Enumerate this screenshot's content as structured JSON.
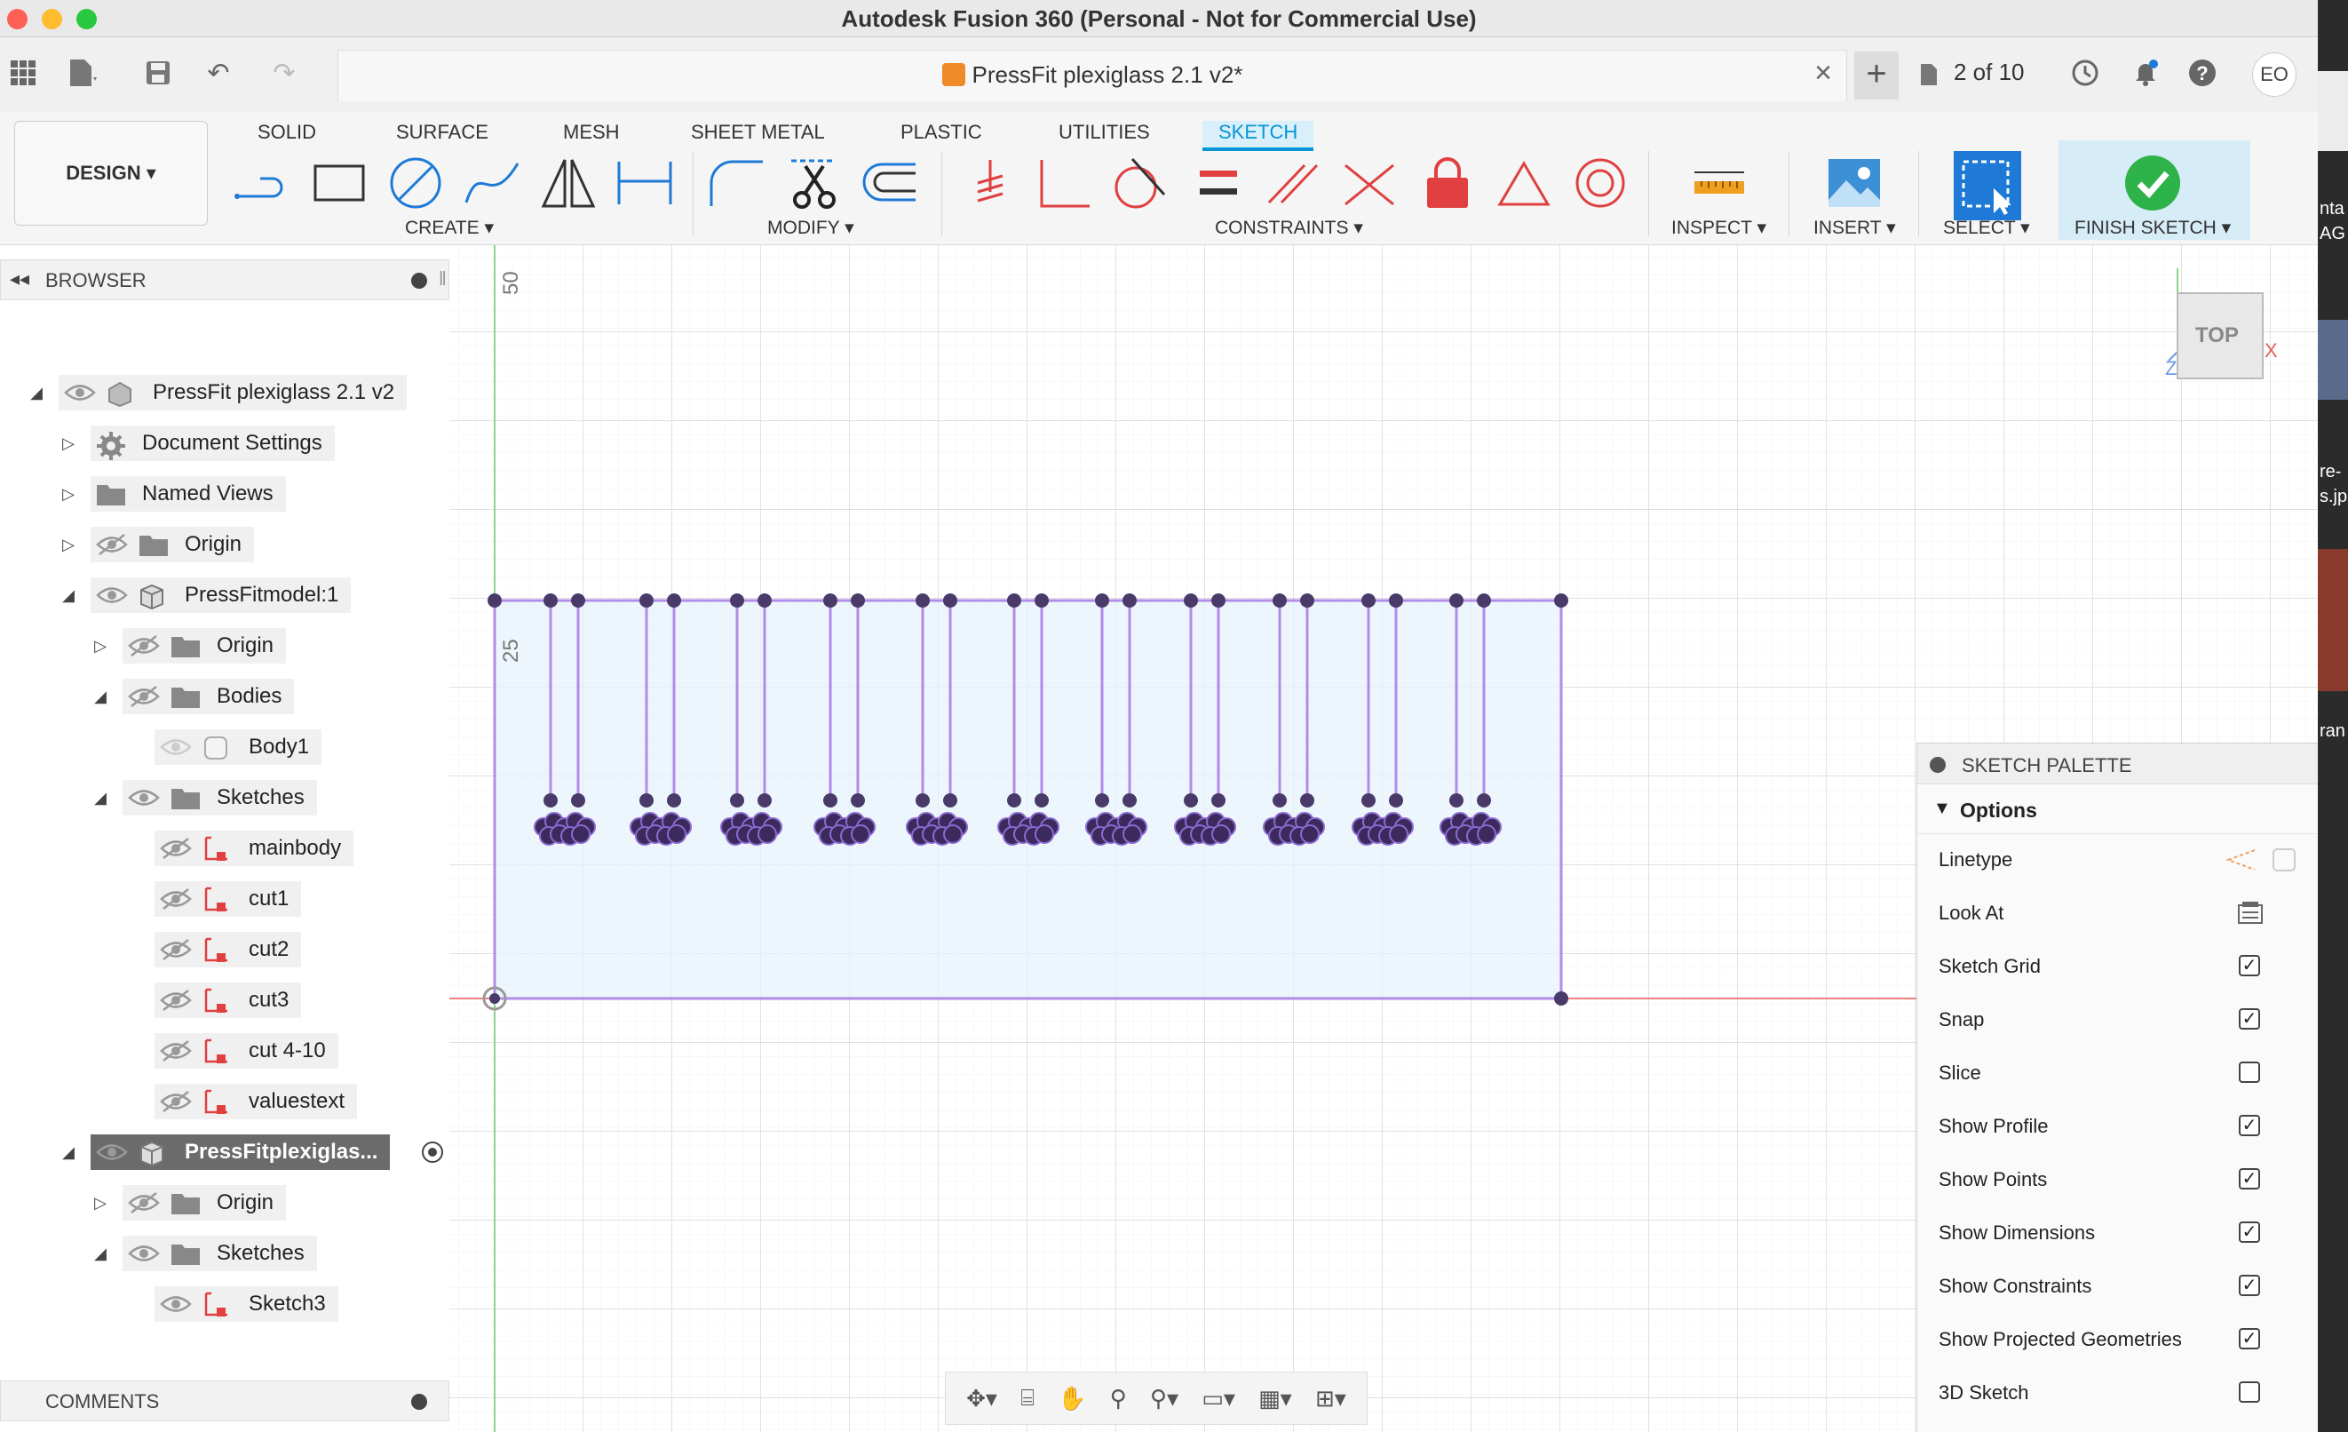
{
  "window": {
    "title": "Autodesk Fusion 360 (Personal - Not for Commercial Use)"
  },
  "tabbar": {
    "doc_title": "PressFit plexiglass 2.1 v2*",
    "version": "2 of 10",
    "avatar": "EO"
  },
  "ribbon": {
    "workspace": "DESIGN ▾",
    "tabs": [
      "SOLID",
      "SURFACE",
      "MESH",
      "SHEET METAL",
      "PLASTIC",
      "UTILITIES",
      "SKETCH"
    ],
    "active_tab": "SKETCH",
    "groups": {
      "create": "CREATE ▾",
      "modify": "MODIFY ▾",
      "constraints": "CONSTRAINTS ▾",
      "inspect": "INSPECT ▾",
      "insert": "INSERT ▾",
      "select": "SELECT ▾",
      "finish": "FINISH SKETCH ▾"
    },
    "accent": "#0696d7"
  },
  "browser": {
    "title": "BROWSER",
    "items": [
      {
        "label": "PressFit plexiglass 2.1 v2",
        "icon": "document-icon"
      },
      {
        "label": "Document Settings",
        "icon": "gear-icon"
      },
      {
        "label": "Named Views",
        "icon": "folder-icon"
      },
      {
        "label": "Origin",
        "icon": "folder-icon"
      },
      {
        "label": "PressFitmodel:1",
        "icon": "component-icon"
      },
      {
        "label": "Origin",
        "icon": "folder-icon"
      },
      {
        "label": "Bodies",
        "icon": "folder-icon"
      },
      {
        "label": "Body1",
        "icon": "body-icon"
      },
      {
        "label": "Sketches",
        "icon": "folder-icon"
      },
      {
        "label": "mainbody",
        "icon": "sketch-icon"
      },
      {
        "label": "cut1",
        "icon": "sketch-icon"
      },
      {
        "label": "cut2",
        "icon": "sketch-icon"
      },
      {
        "label": "cut3",
        "icon": "sketch-icon"
      },
      {
        "label": "cut 4-10",
        "icon": "sketch-icon"
      },
      {
        "label": "valuestext",
        "icon": "sketch-icon"
      },
      {
        "label": "PressFitplexiglas...",
        "icon": "component-icon"
      },
      {
        "label": "Origin",
        "icon": "folder-icon"
      },
      {
        "label": "Sketches",
        "icon": "folder-icon"
      },
      {
        "label": "Sketch3",
        "icon": "sketch-icon"
      }
    ]
  },
  "canvas": {
    "ruler_labels": [
      "50",
      "25"
    ],
    "viewcube_label": "TOP",
    "axes": {
      "x": "X",
      "z": "Z"
    }
  },
  "comments": {
    "title": "COMMENTS"
  },
  "palette": {
    "title": "SKETCH PALETTE",
    "section": "Options",
    "rows": [
      {
        "label": "Linetype",
        "type": "icons"
      },
      {
        "label": "Look At",
        "type": "icon"
      },
      {
        "label": "Sketch Grid",
        "checked": true
      },
      {
        "label": "Snap",
        "checked": true
      },
      {
        "label": "Slice",
        "checked": false
      },
      {
        "label": "Show Profile",
        "checked": true
      },
      {
        "label": "Show Points",
        "checked": true
      },
      {
        "label": "Show Dimensions",
        "checked": true
      },
      {
        "label": "Show Constraints",
        "checked": true
      },
      {
        "label": "Show Projected Geometries",
        "checked": true
      },
      {
        "label": "3D Sketch",
        "checked": false
      }
    ]
  },
  "side_strip": [
    "nta",
    "AG",
    "re-",
    "s.jp",
    "ran"
  ]
}
